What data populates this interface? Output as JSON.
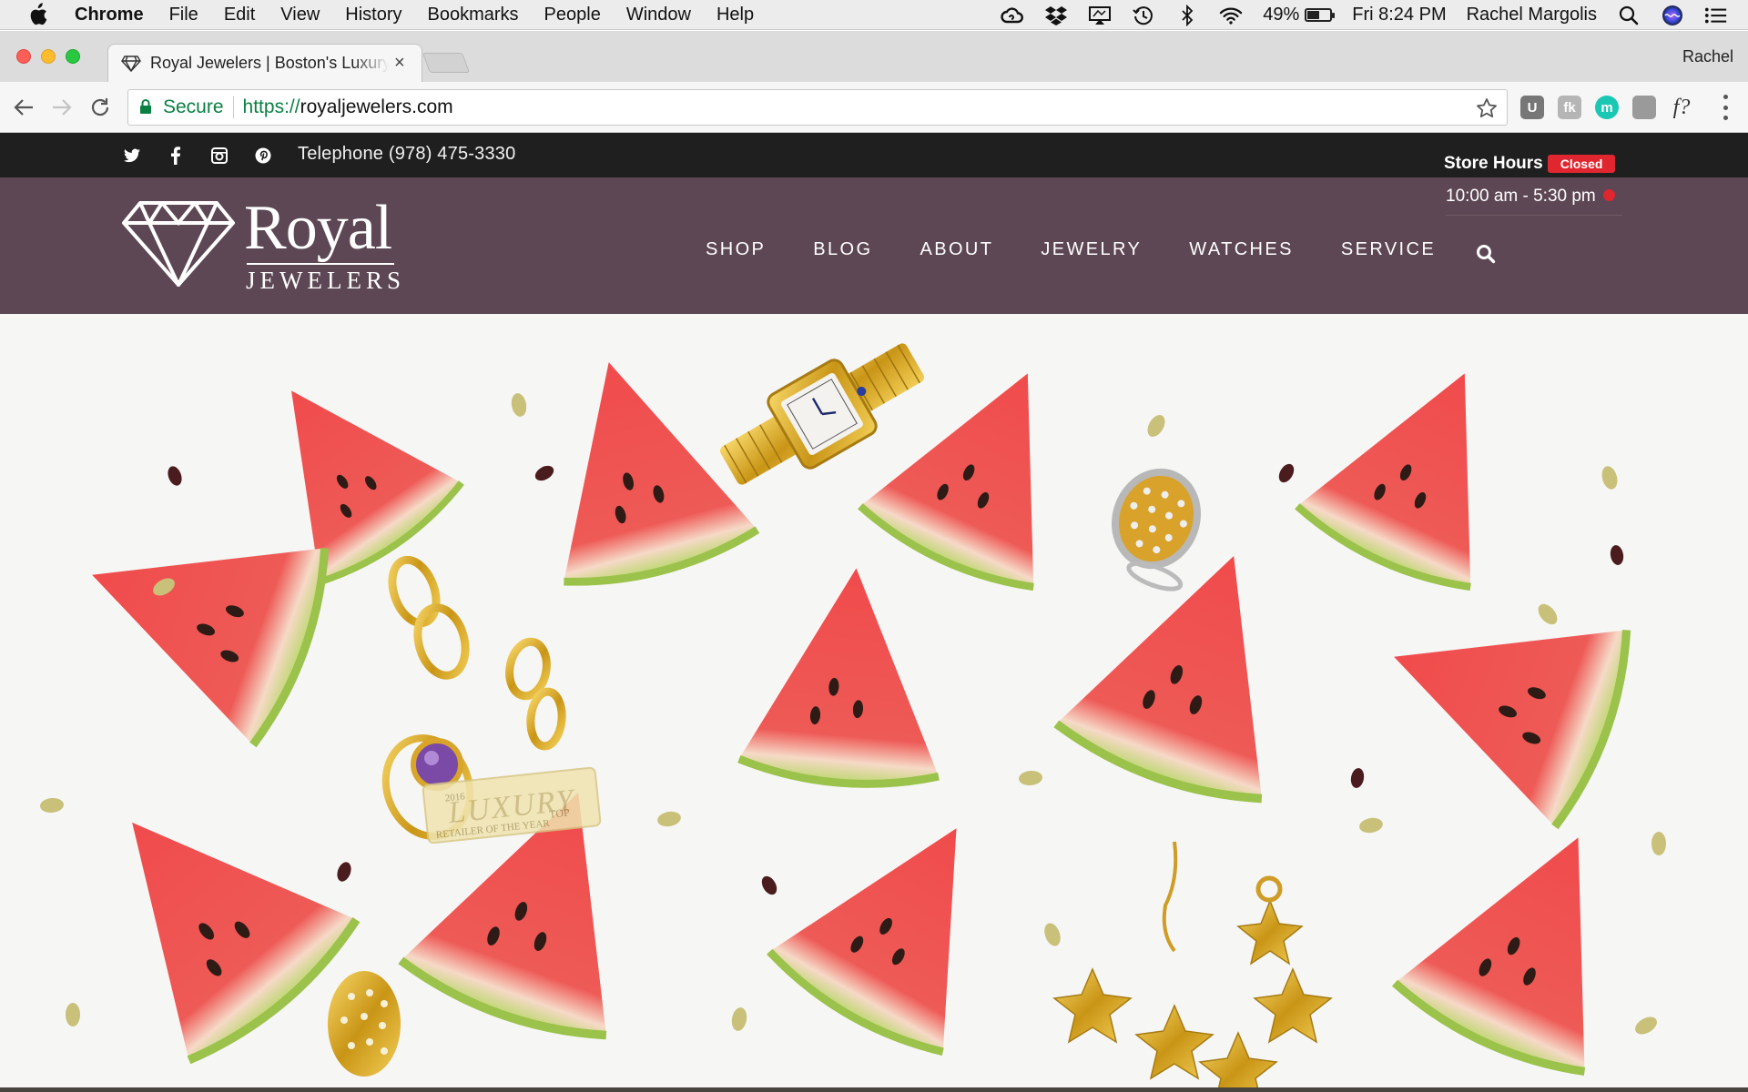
{
  "menubar": {
    "app_name": "Chrome",
    "items": [
      "File",
      "Edit",
      "View",
      "History",
      "Bookmarks",
      "People",
      "Window",
      "Help"
    ],
    "battery_percent": "49%",
    "battery_level": 0.49,
    "clock": "Fri 8:24 PM",
    "user": "Rachel Margolis",
    "status_icons": [
      "creative-cloud-icon",
      "dropbox-icon",
      "airplay-icon",
      "time-machine-icon",
      "bluetooth-icon",
      "wifi-icon",
      "battery-icon",
      "spotlight-icon",
      "siri-icon",
      "notification-center-icon"
    ]
  },
  "browser": {
    "tab_title": "Royal Jewelers | Boston's Luxury Jeweler",
    "profile_name": "Rachel",
    "security_label": "Secure",
    "url_scheme": "https://",
    "url_host": "royaljewelers.com",
    "extensions": [
      {
        "name": "ublock-icon",
        "glyph": "U",
        "color": "#777777"
      },
      {
        "name": "hootsuite-icon",
        "glyph": "fk",
        "color": "#b5b5b5"
      },
      {
        "name": "mixmax-icon",
        "glyph": "m",
        "color": "#19c7b3"
      },
      {
        "name": "clipper-icon",
        "glyph": "",
        "color": "#9a9a9a"
      },
      {
        "name": "fontface-ninja-icon",
        "glyph": "f?",
        "color": "#333333"
      }
    ]
  },
  "site": {
    "topbar": {
      "social": [
        "twitter-icon",
        "facebook-icon",
        "instagram-icon",
        "pinterest-icon"
      ],
      "telephone": "Telephone (978) 475-3330",
      "store_hours_label": "Store Hours",
      "status_badge": "Closed",
      "status_color": "#e0262e"
    },
    "header": {
      "logo_primary": "Royal",
      "logo_secondary": "JEWELERS",
      "nav": [
        "SHOP",
        "BLOG",
        "ABOUT",
        "JEWELRY",
        "WATCHES",
        "SERVICE"
      ],
      "hours": "10:00 am - 5:30 pm",
      "background": "#5d4754"
    },
    "hero": {
      "description_items": [
        "watermark-badge"
      ],
      "badge_lines": [
        "2016",
        "LUXURY",
        "TOP",
        "RETAILER OF THE YEAR"
      ]
    }
  }
}
